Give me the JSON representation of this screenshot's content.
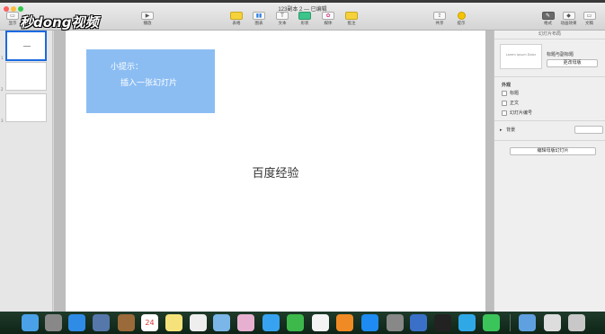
{
  "window": {
    "title": "123副本 2 — 已编辑"
  },
  "watermark": {
    "text": "秒dong视频"
  },
  "toolbar": {
    "view_label": "显示",
    "play_label": "播放",
    "table_label": "表格",
    "chart_label": "图表",
    "text_label": "文本",
    "shape_label": "形状",
    "media_label": "媒体",
    "comment_label": "批注",
    "share_label": "共享",
    "tips_label": "提示",
    "format_label": "格式",
    "animate_label": "动画效果",
    "document_label": "文稿"
  },
  "navigator": {
    "thumbs": [
      {
        "num": "1"
      },
      {
        "num": "2"
      },
      {
        "num": "3"
      }
    ]
  },
  "slide": {
    "tip_title": "小提示：",
    "tip_body": "插入一张幻灯片",
    "title": "百度经验"
  },
  "inspector": {
    "header": "幻灯片布局",
    "layout_name": "标题与副标题",
    "layout_card_text": "Lorem Ipsum Dolor",
    "change_master_button": "更改母版",
    "appearance_label": "外观",
    "checkbox_title": "标题",
    "checkbox_body": "正文",
    "checkbox_slide_number": "幻灯片编号",
    "background_label": "背景",
    "edit_master_button": "编辑母版幻灯片"
  },
  "colors": {
    "tip_box": "#8bbdf3",
    "selection": "#1b6ae0",
    "dock": "#1f3b2a"
  },
  "dock": {
    "calendar_day": "24"
  }
}
